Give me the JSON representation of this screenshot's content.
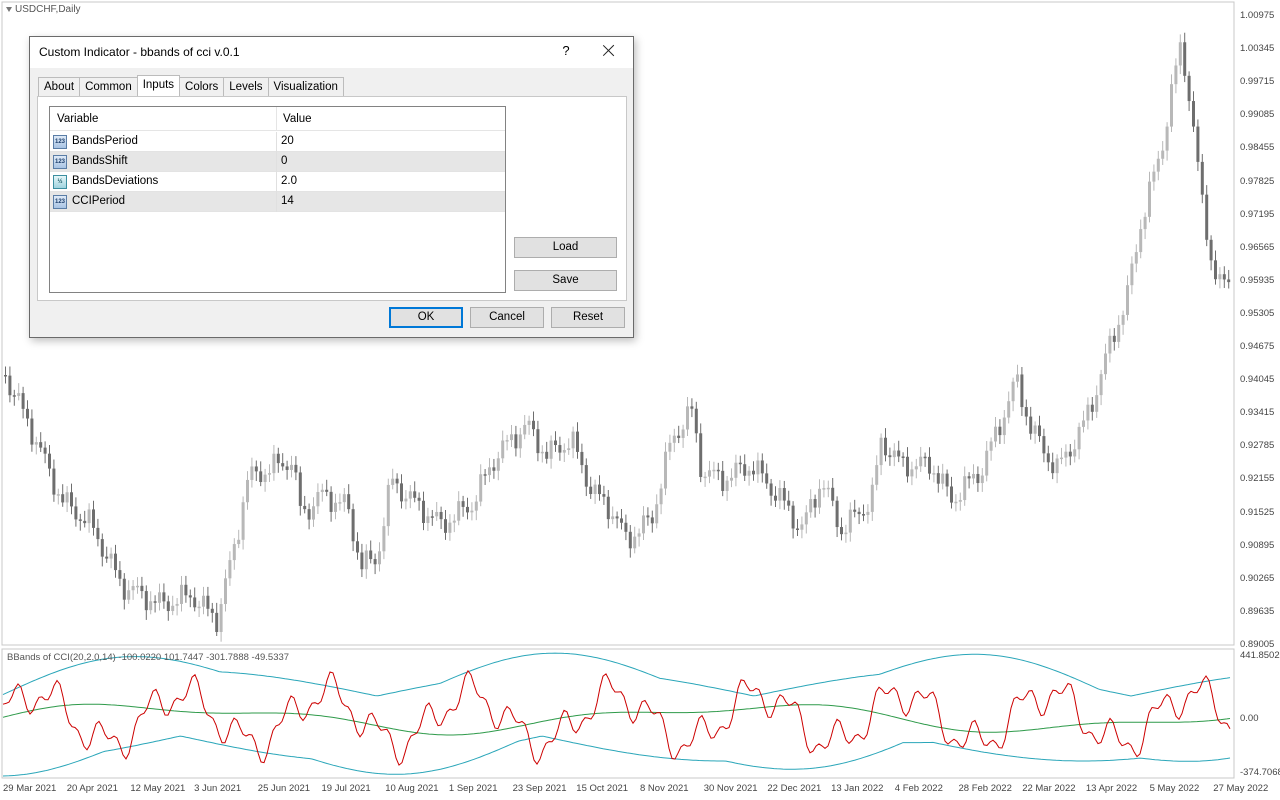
{
  "chart": {
    "symbol": "USDCHF,Daily",
    "indicator_label": "BBands of CCI(20,2.0,14) -100.0220 101.7447 -301.7888 -49.5337",
    "price_ticks": [
      "1.00975",
      "1.00345",
      "0.99715",
      "0.99085",
      "0.98455",
      "0.97825",
      "0.97195",
      "0.96565",
      "0.95935",
      "0.95305",
      "0.94675",
      "0.94045",
      "0.93415",
      "0.92785",
      "0.92155",
      "0.91525",
      "0.90895",
      "0.90265",
      "0.89635",
      "0.89005"
    ],
    "indicator_ticks": [
      "441.8502",
      "0.00",
      "-374.7068"
    ],
    "date_ticks": [
      "29 Mar 2021",
      "20 Apr 2021",
      "12 May 2021",
      "3 Jun 2021",
      "25 Jun 2021",
      "19 Jul 2021",
      "10 Aug 2021",
      "1 Sep 2021",
      "23 Sep 2021",
      "15 Oct 2021",
      "8 Nov 2021",
      "30 Nov 2021",
      "22 Dec 2021",
      "13 Jan 2022",
      "4 Feb 2022",
      "28 Feb 2022",
      "22 Mar 2022",
      "13 Apr 2022",
      "5 May 2022",
      "27 May 2022"
    ],
    "colors": {
      "bull_candle": "#b8b8b8",
      "bear_candle": "#6e6e6e",
      "cci_line": "#cc0000",
      "band_line": "#2aa6b9",
      "middle_line": "#2e9a4a",
      "grid_border": "#c8c8c8"
    }
  },
  "dialog": {
    "title": "Custom Indicator - bbands of cci v.0.1",
    "help_label": "?",
    "tabs": [
      "About",
      "Common",
      "Inputs",
      "Colors",
      "Levels",
      "Visualization"
    ],
    "active_tab": "Inputs",
    "grid": {
      "col_variable": "Variable",
      "col_value": "Value",
      "rows": [
        {
          "icon": "int-icon",
          "icon_text": "123",
          "name": "BandsPeriod",
          "value": "20"
        },
        {
          "icon": "int-icon",
          "icon_text": "123",
          "name": "BandsShift",
          "value": "0"
        },
        {
          "icon": "double-icon",
          "icon_text": "½",
          "name": "BandsDeviations",
          "value": "2.0"
        },
        {
          "icon": "int-icon",
          "icon_text": "123",
          "name": "CCIPeriod",
          "value": "14"
        }
      ]
    },
    "buttons": {
      "load": "Load",
      "save": "Save",
      "ok": "OK",
      "cancel": "Cancel",
      "reset": "Reset"
    }
  }
}
